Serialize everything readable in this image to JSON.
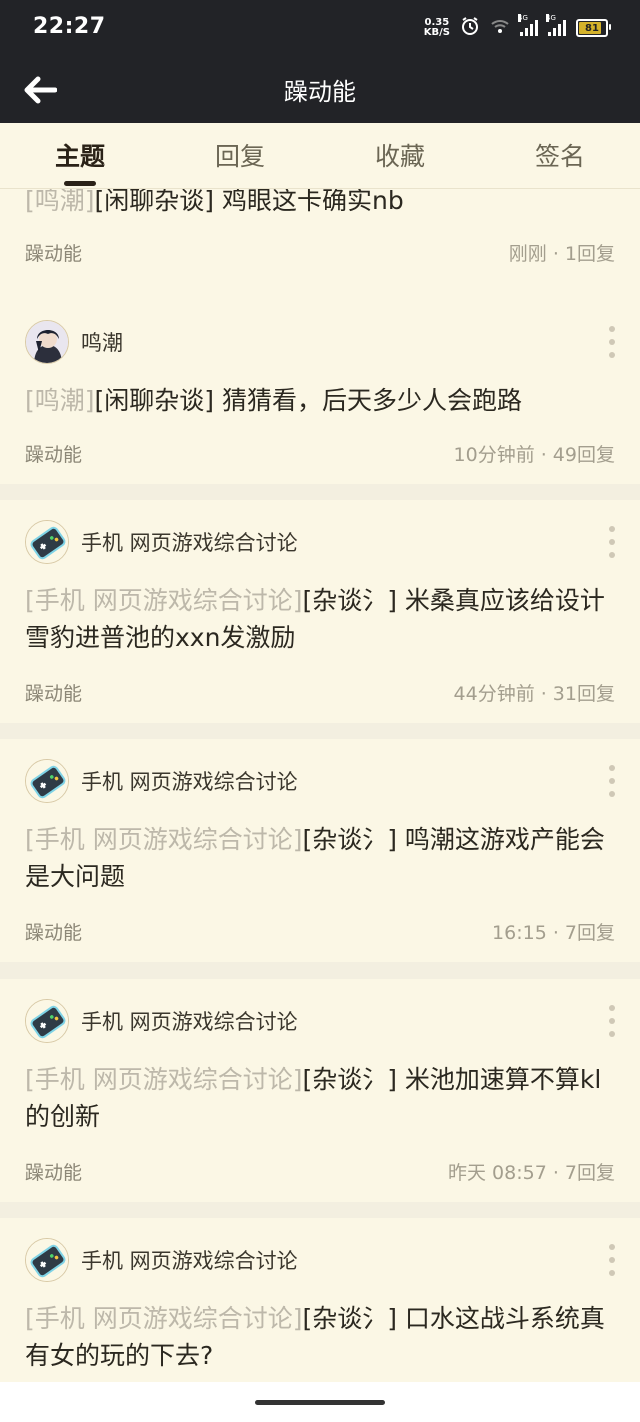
{
  "status_bar": {
    "time": "22:27",
    "net_speed_value": "0.35",
    "net_speed_unit": "KB/S",
    "signal1_label": "4G",
    "signal2_label": "4G",
    "battery": "81"
  },
  "app_bar": {
    "title": "躁动能"
  },
  "tabs": [
    {
      "label": "主题",
      "active": true
    },
    {
      "label": "回复",
      "active": false
    },
    {
      "label": "收藏",
      "active": false
    },
    {
      "label": "签名",
      "active": false
    }
  ],
  "posts": [
    {
      "author": "",
      "title_tag": "[鸣潮]",
      "title_sub": "[闲聊杂谈]",
      "title_text": " 鸡眼这卡确实nb",
      "forum": "躁动能",
      "meta": "刚刚 · 1回复"
    },
    {
      "author": "鸣潮",
      "title_tag": "[鸣潮]",
      "title_sub": "[闲聊杂谈]",
      "title_text": " 猜猜看，后天多少人会跑路",
      "forum": "躁动能",
      "meta": "10分钟前 · 49回复"
    },
    {
      "author": "手机 网页游戏综合讨论",
      "title_tag": "[手机 网页游戏综合讨论]",
      "title_sub": "[杂谈氵]",
      "title_text": " 米桑真应该给设计雪豹进普池的xxn发激励",
      "forum": "躁动能",
      "meta": "44分钟前 · 31回复"
    },
    {
      "author": "手机 网页游戏综合讨论",
      "title_tag": "[手机 网页游戏综合讨论]",
      "title_sub": "[杂谈氵]",
      "title_text": " 鸣潮这游戏产能会是大问题",
      "forum": "躁动能",
      "meta": "16:15 · 7回复"
    },
    {
      "author": "手机 网页游戏综合讨论",
      "title_tag": "[手机 网页游戏综合讨论]",
      "title_sub": "[杂谈氵]",
      "title_text": " 米池加速算不算kl的创新",
      "forum": "躁动能",
      "meta": "昨天  08:57 · 7回复"
    },
    {
      "author": "手机 网页游戏综合讨论",
      "title_tag": "[手机 网页游戏综合讨论]",
      "title_sub": "[杂谈氵]",
      "title_text": " 口水这战斗系统真有女的玩的下去?",
      "forum": "",
      "meta": ""
    }
  ],
  "colors": {
    "header_bg": "#222327",
    "card_bg": "#fbf7e5",
    "page_bg": "#f3efe0",
    "tag_gray": "#bdb8aa",
    "battery_fill": "#d4b22b"
  },
  "icons": {
    "back": "arrow-left-icon",
    "more": "more-vertical-icon",
    "avatar_game": "gamepad-phone-icon",
    "avatar_user": "anime-character-avatar"
  }
}
